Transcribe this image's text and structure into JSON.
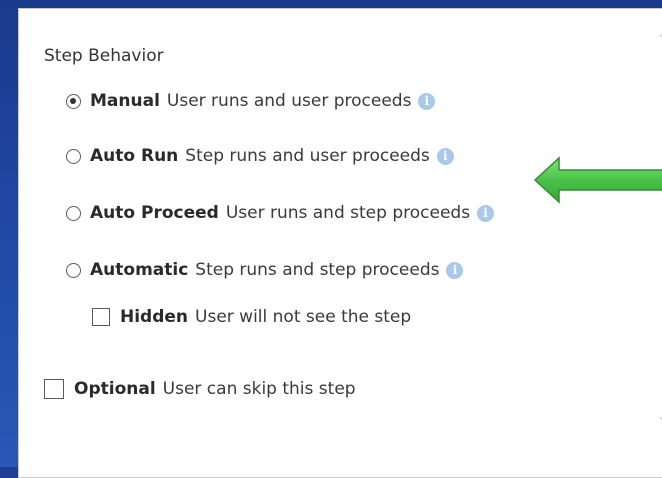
{
  "step_behavior": {
    "label": "Step Behavior",
    "options": [
      {
        "title": "Manual",
        "description": "User runs and user proceeds",
        "selected": true,
        "info_icon": "info-icon"
      },
      {
        "title": "Auto Run",
        "description": "Step runs and user proceeds",
        "selected": false,
        "info_icon": "info-icon"
      },
      {
        "title": "Auto Proceed",
        "description": "User runs and step proceeds",
        "selected": false,
        "info_icon": "info-icon"
      },
      {
        "title": "Automatic",
        "description": "Step runs and step proceeds",
        "selected": false,
        "info_icon": "info-icon"
      }
    ],
    "hidden": {
      "title": "Hidden",
      "description": "User will not see the step",
      "checked": false
    }
  },
  "optional": {
    "title": "Optional",
    "description": "User can skip this step",
    "checked": false
  },
  "info_glyph": "i",
  "colors": {
    "background": "#1e3f92",
    "info_icon": "#a9c9ea",
    "arrow_fill": "#4cc24a",
    "arrow_stroke": "#2f8f2e"
  }
}
